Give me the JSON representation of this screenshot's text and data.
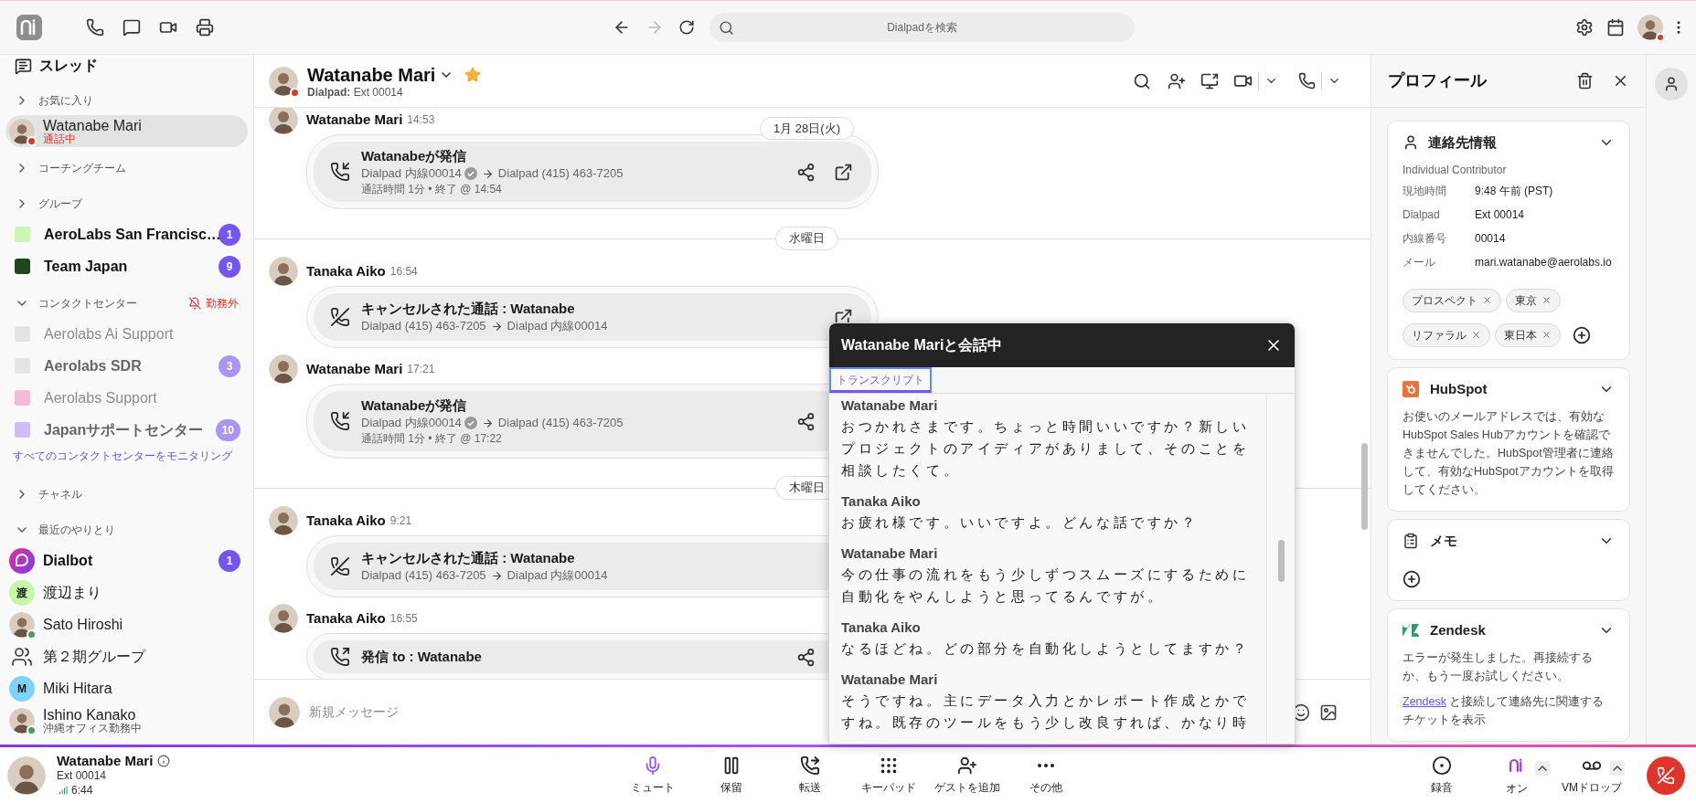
{
  "topbar": {
    "search": {
      "placeholder": "Dialpadを検索"
    },
    "forward": {
      "disabled": true
    }
  },
  "sidebar": {
    "title": "スレッド",
    "sections": [
      {
        "label": "お気に入り",
        "expanded": false,
        "items": [
          {
            "kind": "contact",
            "name": "Watanabe Mari",
            "status": "通話中",
            "busy": true,
            "color": "#e0352b",
            "unread": false,
            "selected": true
          }
        ]
      },
      {
        "label": "コーチングチーム",
        "expanded": false
      },
      {
        "label": "グループ",
        "expanded": false,
        "items": [
          {
            "kind": "square",
            "name": "AeroLabs San Francisc…",
            "color": "#c8f7b8",
            "unread": true,
            "badge": "1",
            "selected": false
          },
          {
            "kind": "square",
            "name": "Team Japan",
            "color": "#1e4620",
            "unread": true,
            "badge": "9",
            "selected": false
          }
        ]
      },
      {
        "label": "コンタクトセンター",
        "expanded": true,
        "off_duty": "勤務外",
        "items": [
          {
            "kind": "square",
            "name": "Aerolabs Ai Support",
            "color": "#e4e4e4",
            "unread": false,
            "selected": false
          },
          {
            "kind": "square",
            "name": "Aerolabs SDR",
            "color": "#e4e4e4",
            "unread": true,
            "badge": "3",
            "selected": false
          },
          {
            "kind": "square",
            "name": "Aerolabs Support",
            "color": "#f2bcd9",
            "unread": false,
            "selected": false
          },
          {
            "kind": "square",
            "name": "Japanサポートセンター",
            "color": "#cdbdf7",
            "unread": true,
            "badge": "10",
            "selected": false
          }
        ],
        "link": "すべてのコンタクトセンターをモニタリング"
      },
      {
        "label": "チャネル",
        "expanded": false
      },
      {
        "label": "最近のやりとり",
        "expanded": true,
        "items": [
          {
            "kind": "bot",
            "name": "Dialbot",
            "unread": true,
            "badge": "1",
            "selected": false
          },
          {
            "kind": "initial",
            "initial": "渡",
            "name": "渡辺まり",
            "color": "#c6f7a6",
            "unread": false,
            "selected": false
          },
          {
            "kind": "photo",
            "name": "Sato Hiroshi",
            "color": "#3aa655",
            "unread": false,
            "selected": false
          },
          {
            "kind": "group",
            "name": "第２期グループ",
            "unread": false,
            "selected": false
          },
          {
            "kind": "initial",
            "initial": "M",
            "name": "Miki Hitara",
            "color": "#7dd3fc",
            "unread": false,
            "selected": false
          },
          {
            "kind": "photo",
            "name": "Ishino Kanako",
            "status": "沖縄オフィス勤務中",
            "busy": false,
            "color": "#3aa655",
            "unread": false,
            "selected": false
          }
        ]
      }
    ]
  },
  "chat": {
    "header": {
      "name": "Watanabe Mari",
      "favorite": true,
      "subtitle": "**Dialpad:** Ext 00014"
    },
    "sticky_date": "1月 28日(火)",
    "feed": [
      {
        "kind": "message",
        "author": "Watanabe Mari",
        "time": "14:53",
        "call": {
          "kind": "outgoing",
          "title": "Watanabeが発信",
          "from": "Dialpad 内線00014",
          "verified": true,
          "to": "Dialpad (415) 463-7205",
          "detail": "通話時間 1分 • 終了 @ 14:54",
          "share": true,
          "open": true
        }
      },
      {
        "kind": "divider",
        "label": "水曜日"
      },
      {
        "kind": "message",
        "author": "Tanaka Aiko",
        "time": "16:54",
        "call": {
          "kind": "cancelled",
          "title": "キャンセルされた通話 : Watanabe",
          "from": "Dialpad (415) 463-7205",
          "verified": false,
          "to": "Dialpad 内線00014",
          "share": false,
          "open": true
        }
      },
      {
        "kind": "message",
        "author": "Watanabe Mari",
        "time": "17:21",
        "call": {
          "kind": "outgoing",
          "title": "Watanabeが発信",
          "from": "Dialpad 内線00014",
          "verified": true,
          "to": "Dialpad (415) 463-7205",
          "detail": "通話時間 1分 • 終了 @ 17:22",
          "share": true,
          "open": false
        }
      },
      {
        "kind": "divider",
        "label": "木曜日"
      },
      {
        "kind": "message",
        "author": "Tanaka Aiko",
        "time": "9:21",
        "call": {
          "kind": "cancelled",
          "title": "キャンセルされた通話 : Watanabe",
          "from": "Dialpad (415) 463-7205",
          "verified": false,
          "to": "Dialpad 内線00014"
        }
      },
      {
        "kind": "message",
        "author": "Tanaka Aiko",
        "time": "16:55",
        "call": {
          "kind": "outgoing_to",
          "title": "発信 to : Watanabe",
          "share": true,
          "open": false
        }
      }
    ],
    "composer": {
      "placeholder": "新規メッセージ"
    }
  },
  "call_popup": {
    "title": "Watanabe Mariと会話中",
    "tabs": [
      {
        "label": "トランスクリプト",
        "selected": true
      }
    ],
    "transcript": [
      {
        "speaker": "Watanabe Mari",
        "text": "おつかれさまです。ちょっと時間いいですか？新しいプロジェクトのアイディアがありまして、そのことを相談したくて。"
      },
      {
        "speaker": "Tanaka Aiko",
        "text": "お疲れ様です。いいですよ。どんな話ですか？"
      },
      {
        "speaker": "Watanabe Mari",
        "text": "今の仕事の流れをもう少しずつスムーズにするために自動化をやんしようと思ってるんですが。"
      },
      {
        "speaker": "Tanaka Aiko",
        "text": "なるほどね。どの部分を自動化しようとしてますか？"
      },
      {
        "speaker": "Watanabe Mari",
        "text": "そうですね。主にデータ入力とかレポート作成とかですね。既存のツールをもう少し改良すれば、かなり時"
      }
    ]
  },
  "profile": {
    "title": "プロフィール",
    "contact": {
      "title": "連絡先情報",
      "role": "Individual Contributor",
      "fields": [
        {
          "label": "現地時間",
          "value": "9:48 午前 (PST)"
        },
        {
          "label": "Dialpad",
          "value": "Ext 00014"
        },
        {
          "label": "内線番号",
          "value": "00014"
        },
        {
          "label": "メール",
          "value": "mari.watanabe@aerolabs.io"
        }
      ],
      "tags": [
        "プロスペクト",
        "東京",
        "リファラル",
        "東日本"
      ]
    },
    "integrations": [
      {
        "kind": "hubspot",
        "title": "HubSpot",
        "text": "お使いのメールアドレスでは、有効なHubSpot Sales Hubアカウントを確認できませんでした。HubSpot管理者に連絡して、有効なHubSpotアカウントを取得してください。"
      },
      {
        "kind": "memo",
        "title": "メモ"
      },
      {
        "kind": "zendesk",
        "title": "Zendesk",
        "text": "エラーが発生しました。再接続するか、もう一度お試しください。",
        "link": "Zendesk",
        "link_suffix": "と接続して連絡先に関連するチケットを表示"
      }
    ]
  },
  "call_bar": {
    "name": "Watanabe Mari",
    "ext": "Ext 00014",
    "duration": "6:44",
    "controls": [
      {
        "kind": "mute",
        "label": "ミュート"
      },
      {
        "kind": "hold",
        "label": "保留"
      },
      {
        "kind": "transfer",
        "label": "転送"
      },
      {
        "kind": "keypad",
        "label": "キーパッド"
      },
      {
        "kind": "add_guest",
        "label": "ゲストを追加"
      },
      {
        "kind": "more",
        "label": "その他"
      }
    ],
    "right_controls": [
      {
        "kind": "record",
        "label": "録音"
      },
      {
        "kind": "ai",
        "label": "オン"
      },
      {
        "kind": "vm_drop",
        "label": "VMドロップ"
      }
    ]
  }
}
